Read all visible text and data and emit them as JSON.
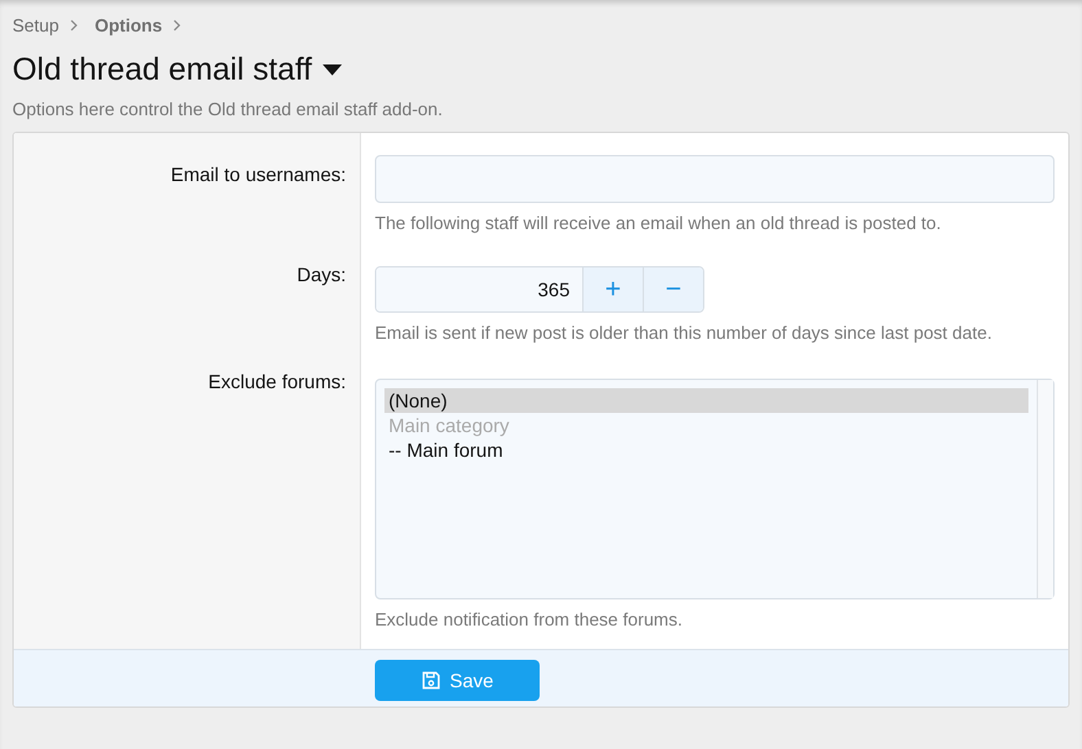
{
  "breadcrumb": [
    {
      "label": "Setup",
      "current": false
    },
    {
      "label": "Options",
      "current": true
    }
  ],
  "title": "Old thread email staff",
  "description": "Options here control the Old thread email staff add-on.",
  "rows": [
    {
      "kind": "text",
      "label": "Email to usernames:",
      "hint": "The following staff will receive an email when an old thread is posted to."
    },
    {
      "kind": "number",
      "label": "Days:",
      "value": "365",
      "plus": "+",
      "minus": "−",
      "hint": "Email is sent if new post is older than this number of days since last post date."
    },
    {
      "kind": "list",
      "label": "Exclude forums:",
      "options": [
        {
          "label": "(None)",
          "selected": true,
          "disabled": false
        },
        {
          "label": "Main category",
          "selected": false,
          "disabled": true
        },
        {
          "label": "-- Main forum",
          "selected": false,
          "disabled": false
        }
      ],
      "hint": "Exclude notification from these forums."
    }
  ],
  "save_button": "Save"
}
